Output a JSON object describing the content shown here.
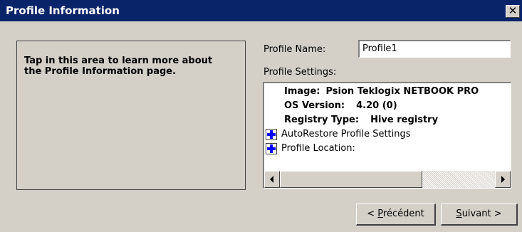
{
  "window": {
    "title": "Profile Information",
    "close_label": "✕"
  },
  "help": {
    "text": "Tap in this area to learn more about the Profile Information page."
  },
  "profile": {
    "name_label": "Profile Name:",
    "name_value": "Profile1",
    "settings_label": "Profile Settings:"
  },
  "settings": {
    "image_key": "Image:",
    "image_value": "Psion Teklogix NETBOOK PRO",
    "os_key": "OS Version:",
    "os_value": "4.20 (0)",
    "registry_key": "Registry Type:",
    "registry_value": "Hive registry",
    "items": [
      {
        "label": "AutoRestore Profile Settings",
        "icon": "plus-expand-icon"
      },
      {
        "label": "Profile Location:",
        "icon": "plus-expand-icon"
      }
    ]
  },
  "buttons": {
    "prev_prefix": "< ",
    "prev_accel": "P",
    "prev_rest": "récédent",
    "next_accel": "S",
    "next_rest": "uivant >"
  },
  "colors": {
    "titlebar": "#0a246a",
    "dialog_bg": "#d4d0c8",
    "expand_icon": "#0000ff"
  }
}
